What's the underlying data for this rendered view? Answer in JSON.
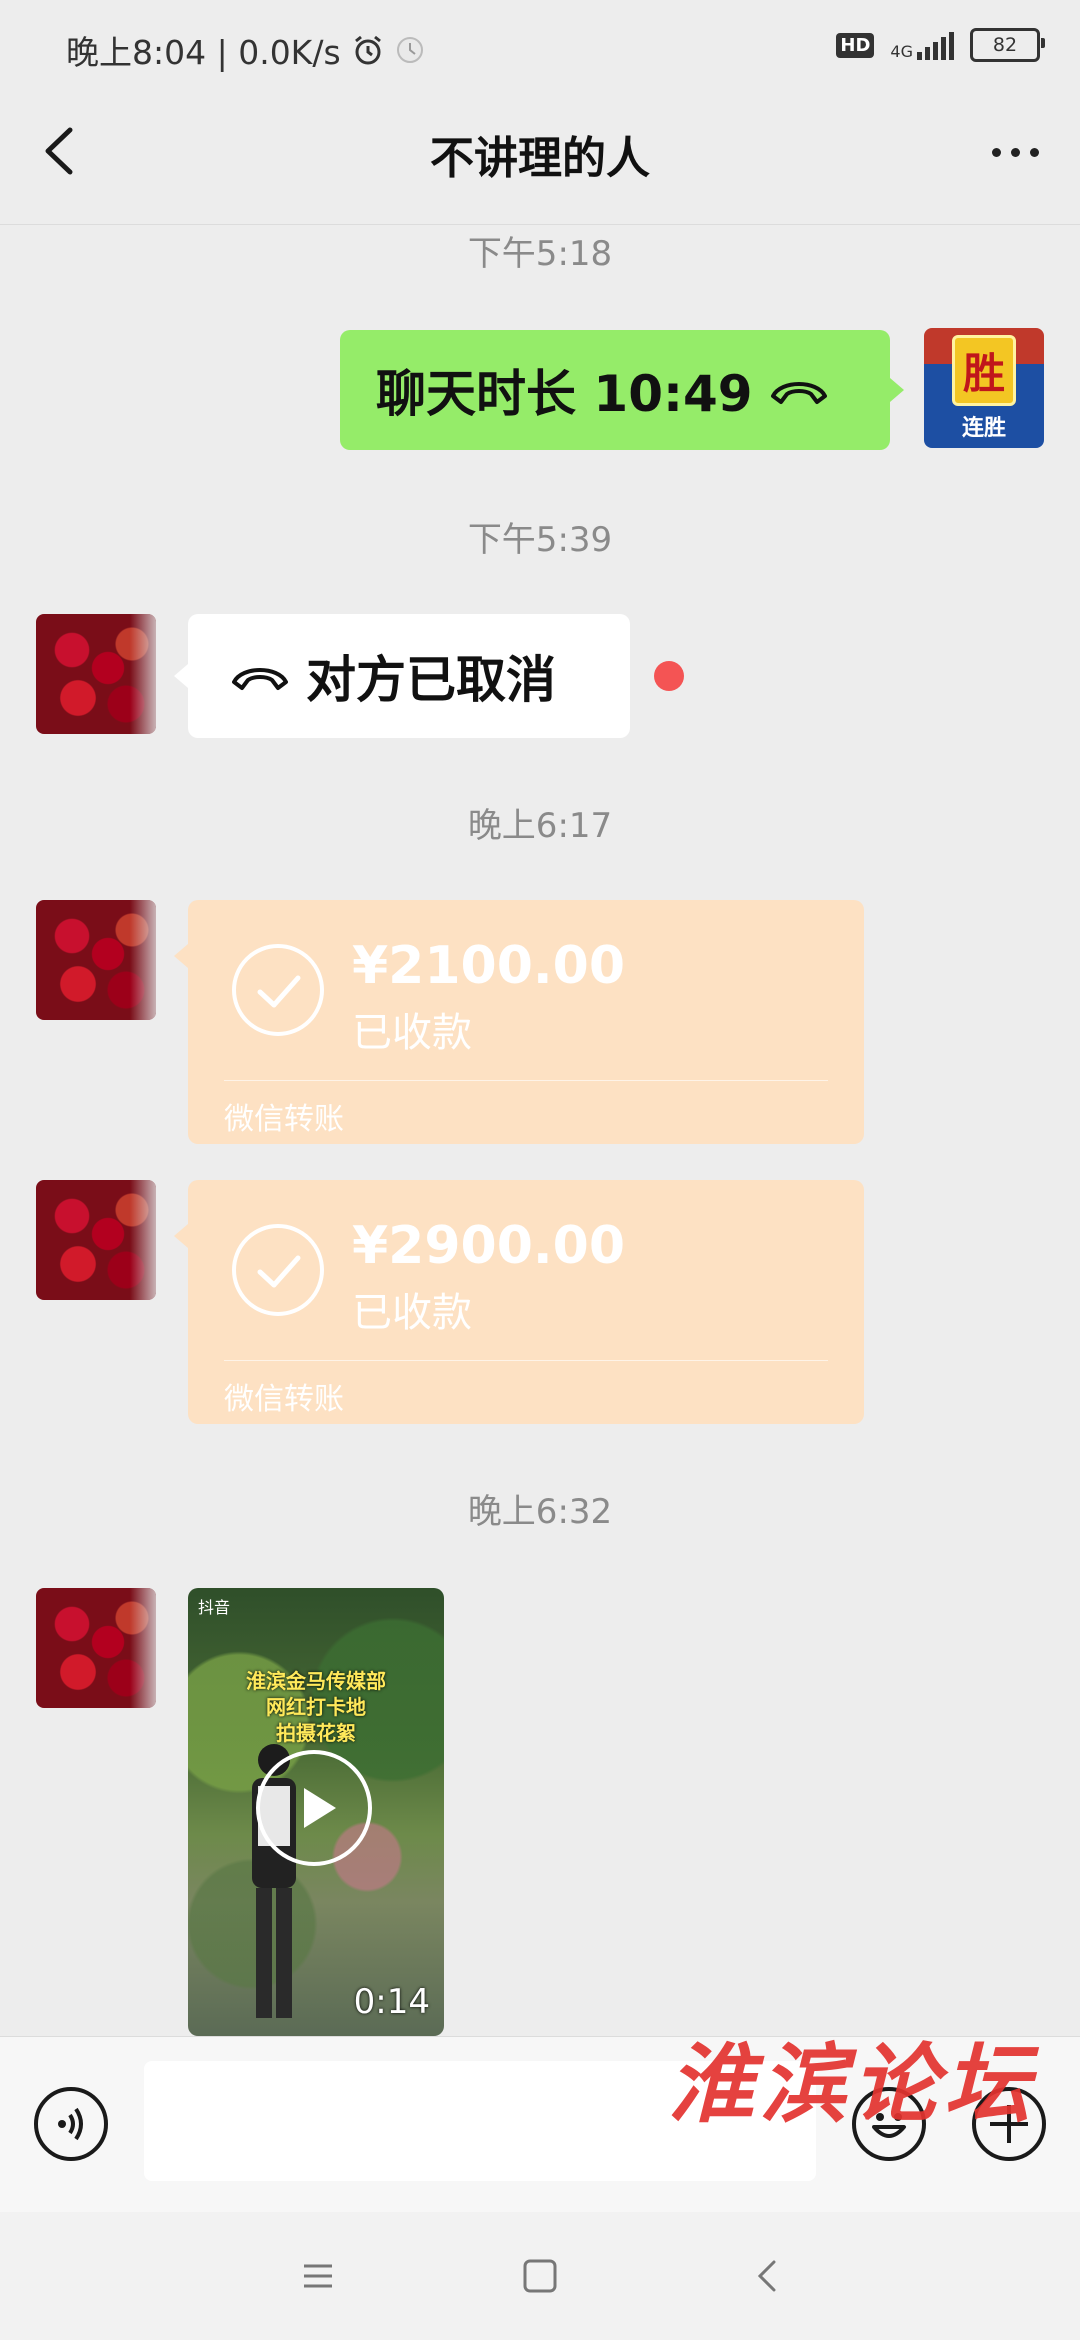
{
  "status_bar": {
    "time_speed": "晚上8:04 | 0.0K/s",
    "hd": "HD",
    "network": "4G",
    "battery": "82"
  },
  "header": {
    "title": "不讲理的人"
  },
  "messages": {
    "time_1": "下午5:18",
    "call_duration": "聊天时长 10:49",
    "time_2": "下午5:39",
    "call_cancelled": "对方已取消",
    "time_3": "晚上6:17",
    "transfer_1": {
      "amount": "¥2100.00",
      "status": "已收款",
      "source": "微信转账"
    },
    "transfer_2": {
      "amount": "¥2900.00",
      "status": "已收款",
      "source": "微信转账"
    },
    "time_4": "晚上6:32",
    "video": {
      "app": "抖音",
      "caption_line1": "淮滨金马传媒部",
      "caption_line2": "网红打卡地",
      "caption_line3": "拍摄花絮",
      "duration": "0:14"
    }
  },
  "self_avatar": {
    "badge_big": "胜",
    "badge_small": "连胜"
  },
  "input": {
    "placeholder": ""
  },
  "watermark": "淮滨论坛",
  "colors": {
    "accent_green": "#95ec69",
    "transfer_orange": "#fde1c3",
    "unread_red": "#f45454",
    "background": "#ededed"
  }
}
